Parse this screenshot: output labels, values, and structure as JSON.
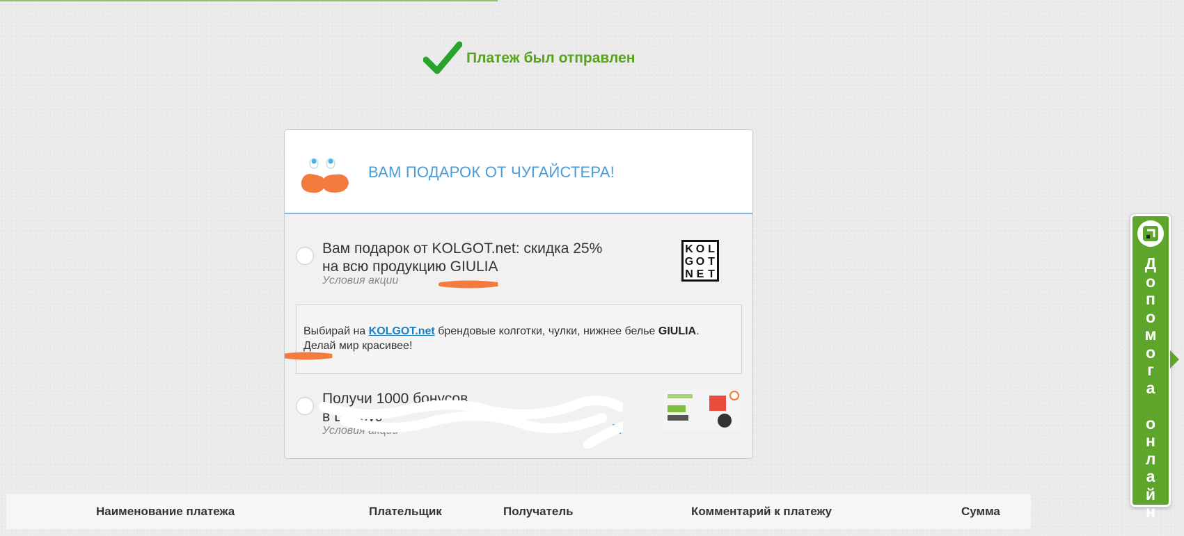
{
  "status": {
    "message": "Платеж был отправлен",
    "icon": "checkmark-icon",
    "color": "#57a31d"
  },
  "promo": {
    "title": "ВАМ ПОДАРОК ОТ ЧУГАЙСТЕРА!",
    "offers": [
      {
        "line1": "Вам подарок от KOLGOT.net: скидка 25%",
        "line2": "на всю продукцию GIULIA",
        "conditions": "Условия акции",
        "logo_text": [
          "K",
          "O",
          "L",
          "G",
          "O",
          "T",
          "N",
          "E",
          "T"
        ],
        "description_prefix": "Выбирай на ",
        "description_link": "KOLGOT.net",
        "description_middle": " брендовые колготки, чулки, нижнее белье ",
        "description_brand": "GIULIA",
        "description_suffix": ". Делай мир красивее!"
      },
      {
        "line1": "Получи 1000 бонусов",
        "line2": "в Цитрус",
        "conditions": "Условия акции",
        "link_fragment": "А."
      }
    ]
  },
  "table": {
    "columns": [
      "Наименование платежа",
      "Плательщик",
      "Получатель",
      "Комментарий к платежу",
      "Сумма"
    ]
  },
  "help_widget": {
    "label": "Допомога онлайн",
    "color": "#5ea62b"
  },
  "colors": {
    "accent_blue": "#4a9ad6",
    "link_blue": "#1c7fc4",
    "scribble_orange": "#f47b3e"
  }
}
